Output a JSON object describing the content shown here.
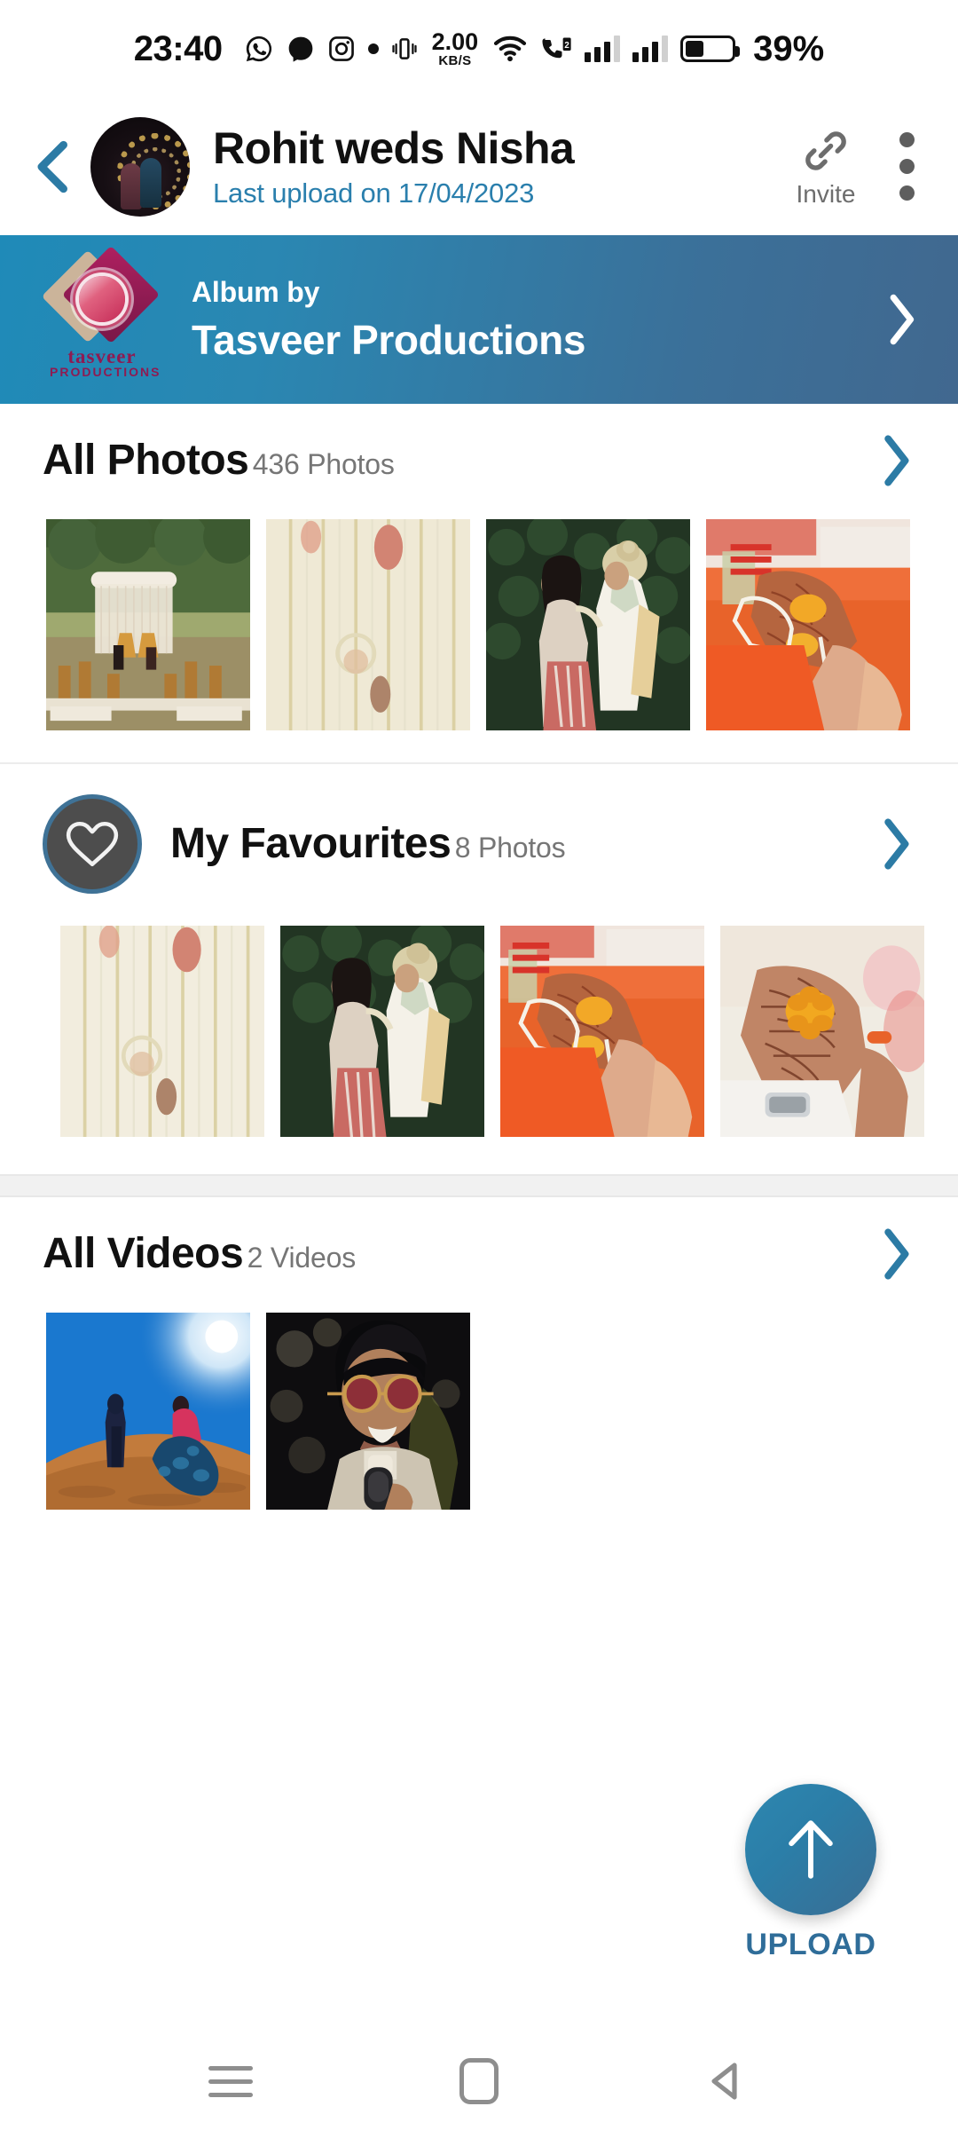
{
  "statusbar": {
    "time": "23:40",
    "icons": [
      "whatsapp-icon",
      "messenger-icon",
      "instagram-icon",
      "dot-icon",
      "vibrate-icon"
    ],
    "net_speed_value": "2.00",
    "net_speed_unit": "KB/S",
    "wifi": "wifi-icon",
    "call_sim": "call-sim-icon",
    "signal_sim1": "signal-bars-icon",
    "signal_sim2": "signal-bars-icon",
    "battery_percent": "39%"
  },
  "header": {
    "back": "back-chevron-icon",
    "avatar": "album-cover-avatar",
    "title": "Rohit weds Nisha",
    "subtitle": "Last upload on 17/04/2023",
    "invite_icon": "link-chain-icon",
    "invite_label": "Invite",
    "menu": "more-vertical-icon"
  },
  "banner": {
    "logo_word": "tasveer",
    "logo_sub": "PRODUCTIONS",
    "eyebrow": "Album by",
    "studio": "Tasveer Productions",
    "chevron": "chevron-right-icon",
    "gradient_start": "#1f8ab8",
    "gradient_end": "#41688f"
  },
  "sections": [
    {
      "id": "all-photos",
      "title": "All Photos",
      "count": "436 Photos",
      "chevron": "chevron-right-icon",
      "thumbs": [
        "mandap-decor-photo",
        "hanging-floral-strings-photo",
        "couple-portrait-photo",
        "mehndi-hands-bangles-photo"
      ]
    },
    {
      "id": "my-favourites",
      "title": "My Favourites",
      "count": "8 Photos",
      "icon": "heart-icon",
      "chevron": "chevron-right-icon",
      "thumbs": [
        "hanging-floral-strings-photo",
        "couple-portrait-photo",
        "mehndi-hands-bangles-photo",
        "mehndi-hand-marigold-photo"
      ]
    },
    {
      "id": "all-videos",
      "title": "All Videos",
      "count": "2 Videos",
      "chevron": "chevron-right-icon",
      "thumbs": [
        "desert-couple-video",
        "singer-microphone-video"
      ]
    }
  ],
  "upload": {
    "icon": "arrow-up-icon",
    "label": "UPLOAD",
    "accent": "#2f6d99"
  },
  "navbar": {
    "recents": "menu-lines-icon",
    "home": "home-square-icon",
    "back": "back-triangle-icon"
  },
  "colors": {
    "accent_blue": "#2a7fad",
    "chevron_blue": "#2c7ba5",
    "muted_text": "#767676"
  }
}
